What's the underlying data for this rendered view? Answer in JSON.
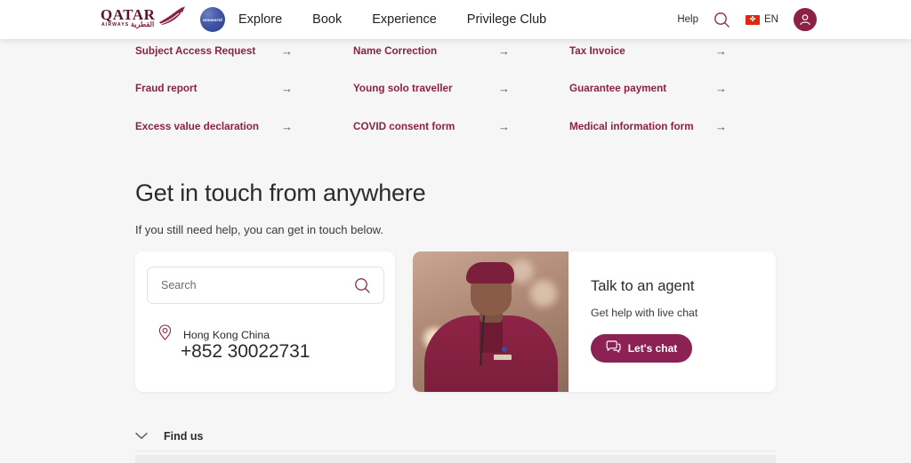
{
  "header": {
    "logo": {
      "word": "QATAR",
      "sub": "AIRWAYS",
      "arabic": "القطرية",
      "alt": "qatar-airways-logo"
    },
    "oneworld_label": "oneworld",
    "nav": [
      {
        "label": "Explore"
      },
      {
        "label": "Book"
      },
      {
        "label": "Experience"
      },
      {
        "label": "Privilege Club"
      }
    ],
    "help_label": "Help",
    "language_code": "EN",
    "flag_glyph": "✤",
    "search_icon": "search-icon",
    "avatar_icon": "user-avatar-icon"
  },
  "link_grid": {
    "arrow_glyph": "→",
    "rows": [
      [
        {
          "label": "Subject Access Request"
        },
        {
          "label": "Name Correction"
        },
        {
          "label": "Tax Invoice"
        }
      ],
      [
        {
          "label": "Fraud report"
        },
        {
          "label": "Young solo traveller"
        },
        {
          "label": "Guarantee payment"
        }
      ],
      [
        {
          "label": "Excess value declaration"
        },
        {
          "label": "COVID consent form"
        },
        {
          "label": "Medical information form"
        }
      ]
    ]
  },
  "section": {
    "title": "Get in touch from anywhere",
    "subtitle": "If you still need help, you can get in touch below."
  },
  "contact_card": {
    "search_placeholder": "Search",
    "search_value": "",
    "location_icon": "location-pin-icon",
    "location": "Hong Kong China",
    "phone": "+852 30022731"
  },
  "agent_card": {
    "photo_alt": "qatar-airways-cabin-crew-photo",
    "title": "Talk to an agent",
    "subtitle": "Get help with live chat",
    "button_label": "Let's chat",
    "button_icon": "chat-bubble-icon"
  },
  "find_us": {
    "label": "Find us",
    "chevron_icon": "chevron-down-icon"
  },
  "colors": {
    "brand_burgundy": "#8c2144",
    "button_magenta": "#8b2253",
    "page_background": "#f6f6f6",
    "card_white": "#ffffff",
    "text_dark": "#2b2b2b",
    "flag_red": "#de2910"
  }
}
